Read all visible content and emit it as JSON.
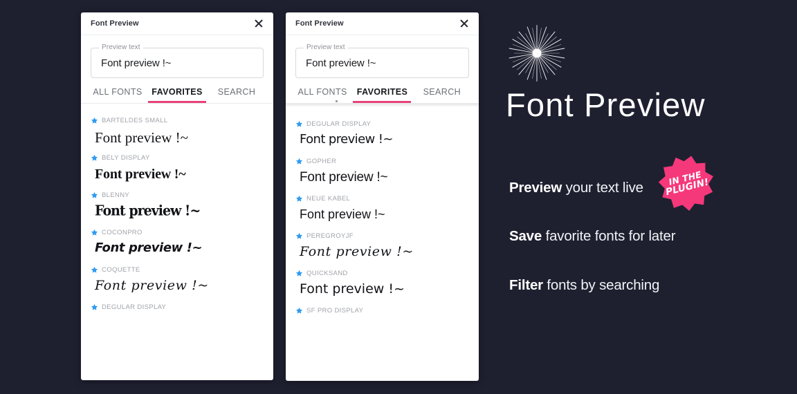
{
  "background_color": "#1e2030",
  "accent_pink": "#e8427b",
  "star_blue": "#2e9bf0",
  "badge_pink": "#f5387a",
  "panels": [
    {
      "id": "panel-1",
      "title": "Font Preview",
      "close_icon": "close-icon",
      "field": {
        "legend": "Preview text",
        "value": "Font preview !~",
        "placeholder": "Font preview !~"
      },
      "tabs": [
        {
          "label": "ALL FONTS",
          "active": false
        },
        {
          "label": "FAVORITES",
          "active": true
        },
        {
          "label": "SEARCH",
          "active": false
        }
      ],
      "scrolled": false,
      "fonts": [
        {
          "name": "BARTELDES SMALL",
          "sample": "Font preview !~",
          "style": "s-serif",
          "favorited": true
        },
        {
          "name": "BELY DISPLAY",
          "sample": "Font preview !~",
          "style": "s-fatserif",
          "favorited": true
        },
        {
          "name": "BLENNY",
          "sample": "Font preview !~",
          "style": "s-heavy",
          "favorited": true
        },
        {
          "name": "COCONPRO",
          "sample": "Font preview !~",
          "style": "s-italic",
          "favorited": true
        },
        {
          "name": "COQUETTE",
          "sample": "Font preview !~",
          "style": "s-script",
          "favorited": true
        },
        {
          "name": "DEGULAR DISPLAY",
          "sample": "",
          "style": "s-sans",
          "favorited": true
        }
      ]
    },
    {
      "id": "panel-2",
      "title": "Font Preview",
      "close_icon": "close-icon",
      "field": {
        "legend": "Preview text",
        "value": "Font preview !~",
        "placeholder": "Font preview !~"
      },
      "tabs": [
        {
          "label": "ALL FONTS",
          "active": false
        },
        {
          "label": "FAVORITES",
          "active": true
        },
        {
          "label": "SEARCH",
          "active": false
        }
      ],
      "scrolled": true,
      "fonts": [
        {
          "name": "DEGULAR DISPLAY",
          "sample": "Font preview !~",
          "style": "s-sans",
          "favorited": true
        },
        {
          "name": "GOPHER",
          "sample": "Font preview !~",
          "style": "s-geo",
          "favorited": true
        },
        {
          "name": "NEUE KABEL",
          "sample": "Font preview !~",
          "style": "s-thin",
          "favorited": true
        },
        {
          "name": "PEREGROYJF",
          "sample": "Font preview !~",
          "style": "s-script",
          "favorited": true
        },
        {
          "name": "QUICKSAND",
          "sample": "Font preview !~",
          "style": "s-round",
          "favorited": true
        },
        {
          "name": "SF PRO DISPLAY",
          "sample": "",
          "style": "s-geo",
          "favorited": true
        }
      ]
    }
  ],
  "promo": {
    "logo_icon": "starburst-icon",
    "product_name": "Font Preview",
    "badge": {
      "line1": "IN THE",
      "line2": "PLUGIN!"
    },
    "features": [
      {
        "strong": "Preview",
        "rest": " your text live"
      },
      {
        "strong": "Save",
        "rest": " favorite fonts for later"
      },
      {
        "strong": "Filter",
        "rest": " fonts by searching"
      }
    ]
  }
}
